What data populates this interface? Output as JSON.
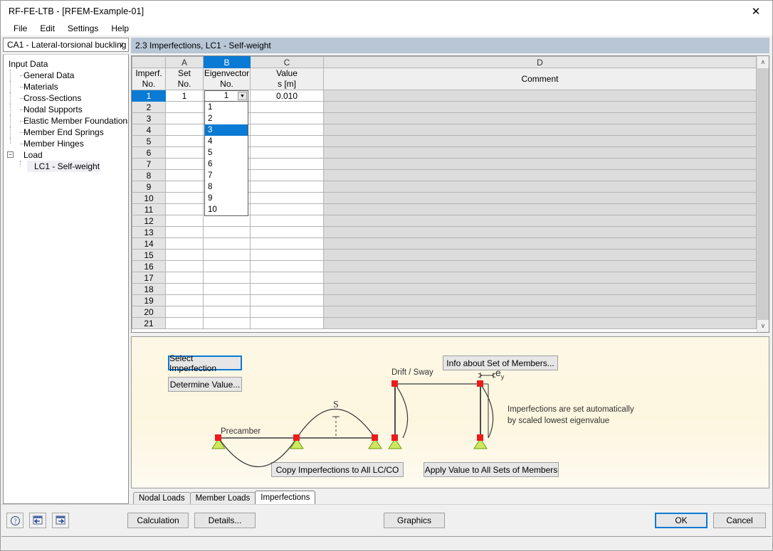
{
  "window": {
    "title": "RF-FE-LTB - [RFEM-Example-01]",
    "close_icon": "close-icon"
  },
  "menu": {
    "items": [
      "File",
      "Edit",
      "Settings",
      "Help"
    ]
  },
  "sidebar": {
    "combo": {
      "value": "CA1 - Lateral-torsional buckling",
      "chevron": "∨"
    },
    "tree": {
      "root": "Input Data",
      "items": [
        "General Data",
        "Materials",
        "Cross-Sections",
        "Nodal Supports",
        "Elastic Member Foundations",
        "Member End Springs",
        "Member Hinges"
      ],
      "load_group": {
        "label": "Load",
        "expander": "−",
        "children": [
          "LC1 - Self-weight"
        ]
      }
    }
  },
  "main": {
    "header": "2.3 Imperfections, LC1 - Self-weight",
    "table": {
      "column_letters": [
        "A",
        "B",
        "C",
        "D"
      ],
      "selected_column_letter": "B",
      "headers": {
        "row_no": [
          "Imperf.",
          "No."
        ],
        "a": [
          "Set",
          "No."
        ],
        "b": [
          "Eigenvector",
          "No."
        ],
        "c": [
          "Value",
          "s [m]"
        ],
        "d": [
          "Comment"
        ]
      },
      "row_numbers": [
        1,
        2,
        3,
        4,
        5,
        6,
        7,
        8,
        9,
        10,
        11,
        12,
        13,
        14,
        15,
        16,
        17,
        18,
        19,
        20,
        21
      ],
      "selected_row": 1,
      "row1": {
        "set_no": "1",
        "eigenvector_no": "1",
        "value": "0.010",
        "comment": ""
      },
      "dropdown": {
        "open": true,
        "arrow": "▼",
        "options": [
          "1",
          "2",
          "3",
          "4",
          "5",
          "6",
          "7",
          "8",
          "9",
          "10"
        ],
        "highlighted": "3"
      },
      "scrollbar": {
        "up_arrow": "∧",
        "down_arrow": "∨"
      }
    },
    "panel": {
      "buttons": {
        "select_imperfection": "Select Imperfection",
        "determine_value": "Determine Value...",
        "info_set_members": "Info about Set of Members...",
        "copy_imperfections": "Copy Imperfections to All LC/CO",
        "apply_value": "Apply Value to All Sets of Members"
      },
      "diagram": {
        "precamber_label": "Precamber",
        "s_label": "S",
        "drift_sway_label": "Drift / Sway",
        "ey_label": "e",
        "ey_sub": "y"
      },
      "note_lines": [
        "Imperfections are set automatically",
        "by scaled lowest eigenvalue"
      ]
    },
    "tabs": [
      {
        "label": "Nodal Loads",
        "active": false
      },
      {
        "label": "Member Loads",
        "active": false
      },
      {
        "label": "Imperfections",
        "active": true
      }
    ]
  },
  "footer": {
    "icon_buttons": [
      "help-icon",
      "previous-icon",
      "next-icon"
    ],
    "calculation": "Calculation",
    "details": "Details...",
    "graphics": "Graphics",
    "ok": "OK",
    "cancel": "Cancel"
  },
  "colors": {
    "accent": "#0a7ad4",
    "header_bar": "#b8c6d6",
    "panel_bg": "#fdf8e6",
    "node_red": "#e81e1e",
    "support_green": "#c8e85a"
  }
}
